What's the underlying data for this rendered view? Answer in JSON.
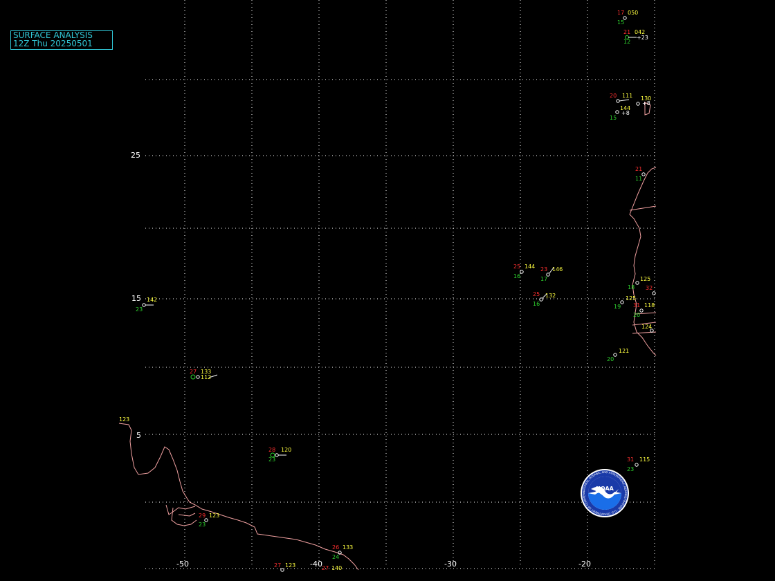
{
  "title": {
    "line1": "SURFACE ANALYSIS",
    "line2": "12Z Thu 20250501"
  },
  "colors": {
    "title": "#31c7d6",
    "grid": "#ffffff",
    "coastline": "#f0a0a0",
    "temperature": "#ff3030",
    "dewpoint": "#2fd62f",
    "pressure": "#ffff40",
    "background": "#000000"
  },
  "axes": {
    "longitude_labels": [
      "-50",
      "-40",
      "-30",
      "-20"
    ],
    "latitude_labels": [
      "25",
      "15",
      "5"
    ]
  },
  "stations": [
    {
      "temp": "17",
      "pres": "050",
      "dew": "15",
      "tend": ""
    },
    {
      "temp": "21",
      "pres": "042",
      "dew": "12",
      "tend": "+23"
    },
    {
      "temp": "20",
      "pres": "111",
      "dew": "15",
      "tend": ""
    },
    {
      "temp": "",
      "pres": "130",
      "dew": "",
      "tend": "+8"
    },
    {
      "temp": "",
      "pres": "144",
      "dew": "",
      "tend": "+8"
    },
    {
      "temp": "21",
      "pres": "",
      "dew": "11",
      "tend": ""
    },
    {
      "temp": "25",
      "pres": "144",
      "dew": "16",
      "tend": ""
    },
    {
      "temp": "23",
      "pres": "146",
      "dew": "17",
      "tend": ""
    },
    {
      "temp": "25",
      "pres": "132",
      "dew": "16",
      "tend": ""
    },
    {
      "temp": "",
      "pres": "142",
      "dew": "23",
      "tend": ""
    },
    {
      "temp": "",
      "pres": "125",
      "dew": "18",
      "tend": ""
    },
    {
      "temp": "32",
      "pres": "",
      "dew": "",
      "tend": ""
    },
    {
      "temp": "",
      "pres": "125",
      "dew": "19",
      "tend": ""
    },
    {
      "temp": "31",
      "pres": "118",
      "dew": "20",
      "tend": ""
    },
    {
      "temp": "",
      "pres": "124",
      "dew": "",
      "tend": ""
    },
    {
      "temp": "",
      "pres": "121",
      "dew": "20",
      "tend": ""
    },
    {
      "temp": "27",
      "pres": "133",
      "dew": "",
      "tend": "112"
    },
    {
      "temp": "",
      "pres": "123",
      "dew": "",
      "tend": ""
    },
    {
      "temp": "28",
      "pres": "120",
      "dew": "23",
      "tend": ""
    },
    {
      "temp": "31",
      "pres": "115",
      "dew": "23",
      "tend": ""
    },
    {
      "temp": "29",
      "pres": "123",
      "dew": "23",
      "tend": ""
    },
    {
      "temp": "26",
      "pres": "133",
      "dew": "24",
      "tend": ""
    },
    {
      "temp": "27",
      "pres": "123",
      "dew": "",
      "tend": ""
    },
    {
      "temp": "27",
      "pres": "140",
      "dew": "",
      "tend": ""
    }
  ],
  "logo": {
    "name": "NOAA",
    "ring_text": "NATIONAL OCEANIC AND ATMOSPHERIC ADMINISTRATION · U.S. DEPARTMENT OF COMMERCE"
  }
}
